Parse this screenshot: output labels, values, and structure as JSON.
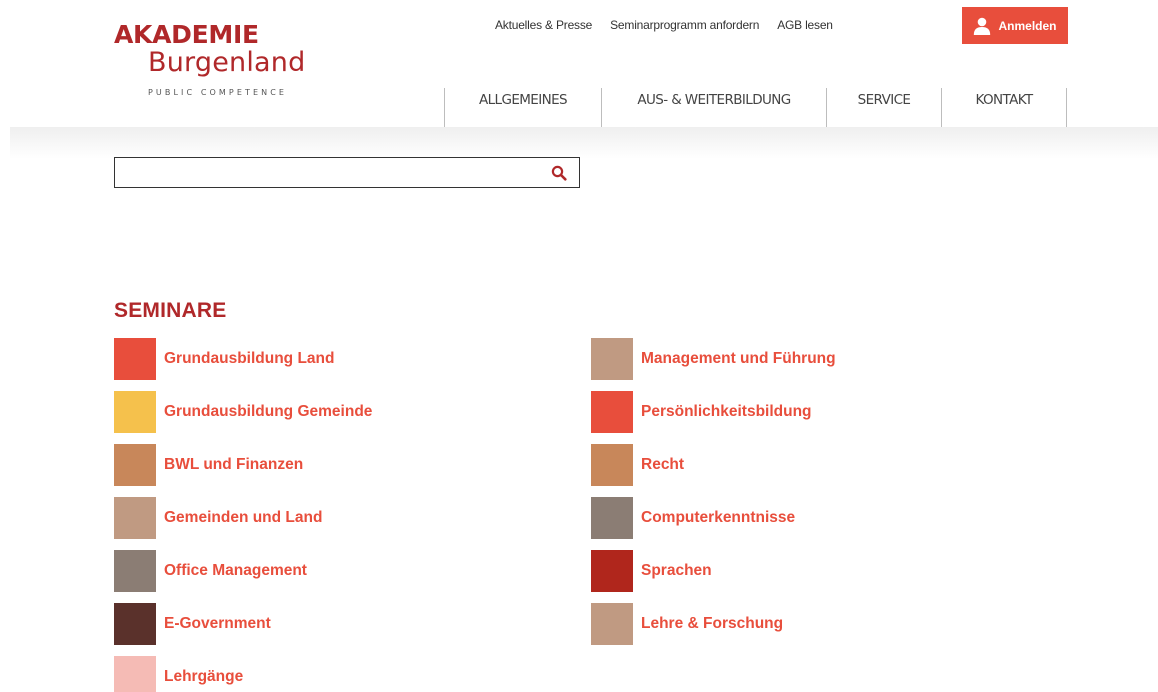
{
  "logo": {
    "line1": "AKADEMIE",
    "line2": "Burgenland",
    "tagline": "PUBLIC COMPETENCE"
  },
  "topnav": [
    {
      "label": "Aktuelles & Presse"
    },
    {
      "label": "Seminarprogramm anfordern"
    },
    {
      "label": "AGB lesen"
    }
  ],
  "login": {
    "label": "Anmelden",
    "icon": "user-icon",
    "color": "#e84e3c"
  },
  "mainnav": [
    {
      "label": "ALLGEMEINES"
    },
    {
      "label": "AUS- & WEITERBILDUNG"
    },
    {
      "label": "SERVICE"
    },
    {
      "label": "KONTAKT"
    }
  ],
  "search": {
    "value": "",
    "placeholder": "",
    "icon": "search-icon"
  },
  "seminare": {
    "title": "SEMINARE",
    "column1": [
      {
        "label": "Grundausbildung Land",
        "color": "#e84e3c"
      },
      {
        "label": "Grundausbildung Gemeinde",
        "color": "#f5c14c"
      },
      {
        "label": "BWL und Finanzen",
        "color": "#c8875a"
      },
      {
        "label": "Gemeinden und Land",
        "color": "#c09a82"
      },
      {
        "label": "Office Management",
        "color": "#8b7d74"
      },
      {
        "label": "E-Government",
        "color": "#5a312b"
      },
      {
        "label": "Lehrgänge",
        "color": "#f5bbb5"
      }
    ],
    "column2": [
      {
        "label": "Management und Führung",
        "color": "#c09a82"
      },
      {
        "label": "Persönlichkeitsbildung",
        "color": "#e84e3c"
      },
      {
        "label": "Recht",
        "color": "#c8875a"
      },
      {
        "label": "Computerkenntnisse",
        "color": "#8b7d74"
      },
      {
        "label": "Sprachen",
        "color": "#b0261c"
      },
      {
        "label": "Lehre & Forschung",
        "color": "#c09a82"
      }
    ]
  },
  "colors": {
    "brand_red": "#b0282a",
    "accent": "#e84e3c"
  }
}
